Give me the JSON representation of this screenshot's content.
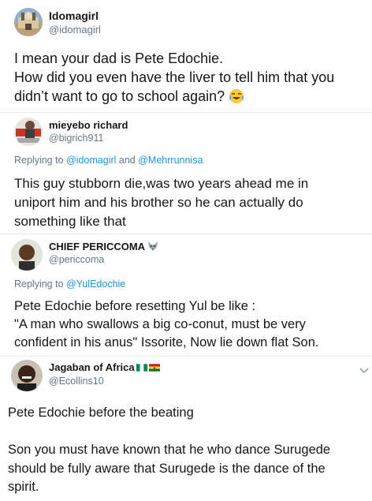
{
  "tweets": [
    {
      "name": "Idomagirl",
      "handle": "@idomagirl",
      "lines": [
        "I mean your dad is Pete Edochie.",
        "How did you even have the liver to tell him that you",
        "didn’t want to go to school again?"
      ],
      "emoji": "face-with-tears-of-joy"
    },
    {
      "name": "mieyebo richard",
      "handle": "@bigrich911",
      "replying_prefix": "Replying to ",
      "replying_to": [
        "@idomagirl",
        "@Mehrrunnisa"
      ],
      "replying_and": " and ",
      "lines": [
        "This guy stubborn die,was two years ahead me in",
        "uniport him and his brother so he can actually do",
        "something like that"
      ]
    },
    {
      "name": "CHIEF PERICCOMA",
      "handle": "@periccoma",
      "name_badge": "wolf-emoji",
      "replying_prefix": "Replying to ",
      "replying_to": [
        "@YulEdochie"
      ],
      "lines": [
        "Pete Edochie before resetting Yul be like :",
        "\"A man who swallows a big co-conut, must be very",
        "confident in his anus\" Issorite, Now lie down flat Son."
      ]
    },
    {
      "name": "Jagaban of Africa",
      "handle": "@Ecollins10",
      "name_badges": [
        "nigeria-flag",
        "ghana-flag"
      ],
      "lines": [
        "Pete Edochie before the beating",
        "",
        "Son you must have known that he who dance Surugede",
        "should be fully aware that Surugede is the dance of the",
        "spirit."
      ]
    }
  ],
  "colors": {
    "text": "#14171a",
    "secondary": "#657786",
    "link": "#1b95e0",
    "divider": "#e6ecf0"
  }
}
